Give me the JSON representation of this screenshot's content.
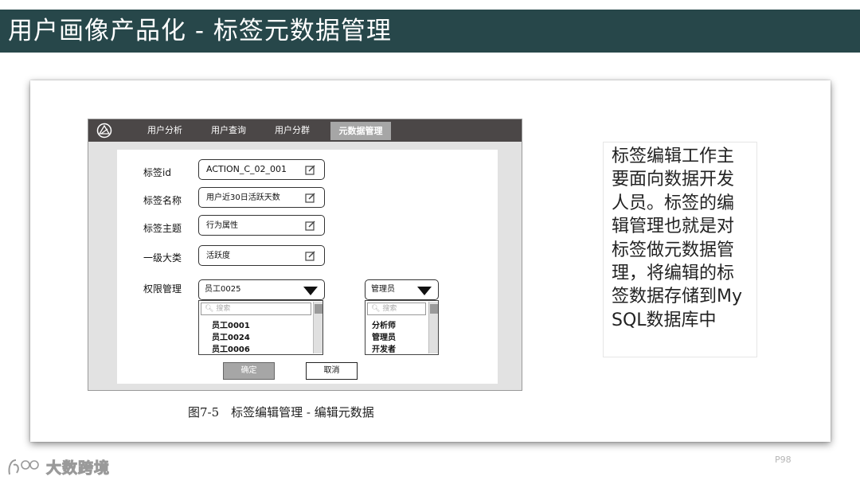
{
  "slide": {
    "title": "用户画像产品化 - 标签元数据管理",
    "page_number": "P98",
    "watermark": "大数跨境"
  },
  "mock": {
    "nav_tabs": [
      "用户分析",
      "用户查询",
      "用户分群",
      "元数据管理"
    ],
    "active_tab": "元数据管理",
    "fields": [
      {
        "label": "标签id",
        "value": "ACTION_C_02_001"
      },
      {
        "label": "标签名称",
        "value": "用户近30日活跃天数"
      },
      {
        "label": "标签主题",
        "value": "行为属性"
      },
      {
        "label": "一级大类",
        "value": "活跃度"
      }
    ],
    "permission": {
      "label": "权限管理",
      "employee_select": {
        "value": "员工0025",
        "search_placeholder": "搜索",
        "options": [
          "员工0001",
          "员工0024",
          "员工0006"
        ]
      },
      "role_select": {
        "value": "管理员",
        "search_placeholder": "搜索",
        "options": [
          "分析师",
          "管理员",
          "开发者"
        ]
      }
    },
    "confirm_label": "确定",
    "cancel_label": "取消"
  },
  "caption": "图7-5　标签编辑管理 - 编辑元数据",
  "note_text": "标签编辑工作主要面向数据开发人员。标签的编辑管理也就是对标签做元数据管理，将编辑的标签数据存储到MySQL数据库中",
  "colors": {
    "title_bar": "#27474a",
    "mock_nav": "#4b4747",
    "active_tab": "#a6a6a6"
  }
}
